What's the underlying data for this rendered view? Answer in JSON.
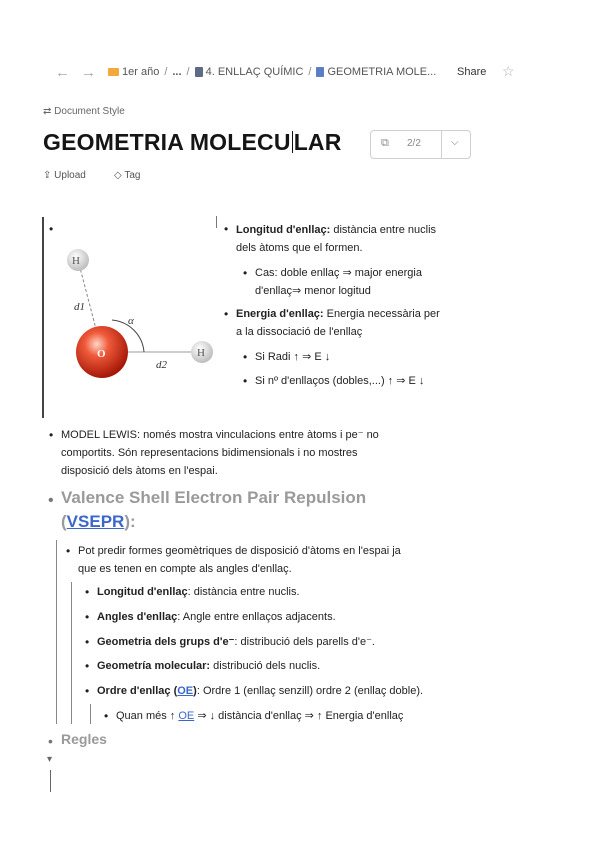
{
  "nav": {
    "back": "←",
    "forward": "→"
  },
  "breadcrumb": {
    "folder": "1er año",
    "ellipsis": "...",
    "section": "4. ENLLAÇ QUÍMIC",
    "current": "GEOMETRIA MOLE..."
  },
  "header": {
    "share": "Share",
    "star": "☆"
  },
  "doc": {
    "style_label": "Document Style",
    "title_part1": "GEOMETRIA MOLECU",
    "title_part2": "LAR",
    "version": "2/2",
    "upload": "Upload",
    "tag": "Tag"
  },
  "figure": {
    "h_top": "H",
    "d1": "d1",
    "alpha": "α",
    "o": "O",
    "d2": "d2",
    "h_right": "H"
  },
  "side_list": {
    "l1_bold": "Longitud d'enllaç:",
    "l1_a": " distància entre nuclis",
    "l1_b": "dels àtoms que el formen.",
    "l1_sub_a": "Cas: doble enllaç ⇒ major energia",
    "l1_sub_b": "d'enllaç⇒ menor logitud",
    "l2_bold": "Energia d'enllaç:",
    "l2_a": " Energia necessària per",
    "l2_b": "a la dissociació de l'enllaç",
    "l2_sub1": "Si Radi ↑ ⇒ E ↓",
    "l2_sub2": "Si nº d'enllaços (dobles,...) ↑ ⇒ E ↓"
  },
  "lewis": {
    "a": "MODEL LEWIS: només mostra vinculacions entre àtoms i pe⁻ no",
    "b": "comportits. Són representacions bidimensionals i no mostres",
    "c": "disposició dels àtoms en l'espai."
  },
  "vsepr": {
    "heading_a": "Valence Shell Electron Pair Repulsion",
    "paren_open": "(",
    "link": "VSEPR",
    "paren_close": "):",
    "intro_a": "Pot predir formes geomètriques de disposició d'àtoms en l'espai ja",
    "intro_b": "que es tenen en compte als angles d'enllaç.",
    "i1_bold": "Longitud d'enllaç",
    "i1_rest": ": distància entre nuclis.",
    "i2_bold": "Angles d'enllaç",
    "i2_rest": ": Angle entre enllaços adjacents.",
    "i3_bold": "Geometria dels grups d'e⁻",
    "i3_rest": ": distribució dels parells d'e⁻.",
    "i4_bold": "Geometría molecular:",
    "i4_rest": " distribució dels nuclis.",
    "i5_bold_a": "Ordre d'enllaç (",
    "i5_link": "OE",
    "i5_bold_b": ")",
    "i5_rest": ": Ordre 1 (enllaç senzill) ordre 2 (enllaç doble).",
    "i5_sub_a": "Quan més ↑ ",
    "i5_sub_link": "OE",
    "i5_sub_b": " ⇒ ↓ distància d'enllaç ⇒ ↑ Energia d'enllaç"
  },
  "regles": {
    "heading": "Regles"
  }
}
